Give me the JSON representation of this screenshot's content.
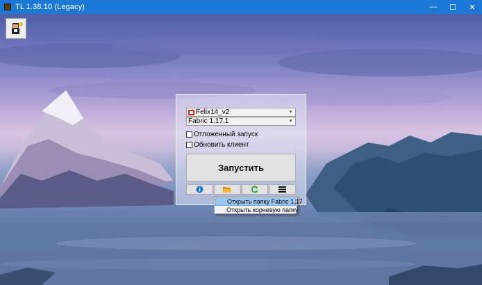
{
  "window": {
    "title": "TL 1.38.10 (Legacy)",
    "icon": "app-icon",
    "buttons": {
      "minimize": "—",
      "maximize": "☐",
      "close": "✕"
    }
  },
  "profile": {
    "icon": "player-avatar-icon"
  },
  "launcher": {
    "account": {
      "value": "Felix14_v2",
      "icon": "account-flag-icon"
    },
    "version": {
      "value": "Fabric 1.17.1"
    },
    "options": [
      {
        "label": "Отложенный запуск",
        "checked": false
      },
      {
        "label": "Обновить клиент",
        "checked": false
      }
    ],
    "launch_label": "Запустить",
    "toolbar": [
      {
        "name": "info",
        "icon": "info-icon",
        "color": "#1a73d0"
      },
      {
        "name": "folder",
        "icon": "folder-icon",
        "color": "#f0a030"
      },
      {
        "name": "refresh",
        "icon": "refresh-icon",
        "color": "#2fa83a"
      },
      {
        "name": "menu",
        "icon": "hamburger-menu-icon",
        "color": "#111111"
      }
    ]
  },
  "folder_menu": {
    "items": [
      {
        "label": "Открыть папку Fabric 1.17",
        "highlighted": true
      },
      {
        "label": "Открыть корневую папку",
        "highlighted": false
      }
    ]
  },
  "colors": {
    "titlebar": "#1b78d6",
    "highlight": "#9ec8f2"
  }
}
